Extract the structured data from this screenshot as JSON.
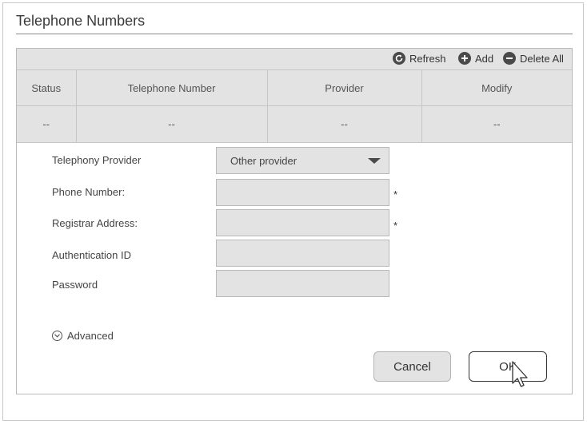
{
  "header": {
    "title": "Telephone Numbers"
  },
  "toolbar": {
    "refresh_label": "Refresh",
    "add_label": "Add",
    "delete_all_label": "Delete All"
  },
  "table": {
    "columns": [
      "Status",
      "Telephone Number",
      "Provider",
      "Modify"
    ],
    "rows": [
      [
        "--",
        "--",
        "--",
        "--"
      ]
    ]
  },
  "form": {
    "provider": {
      "label": "Telephony Provider",
      "value": "Other provider"
    },
    "phone": {
      "label": "Phone Number:",
      "value": "",
      "required_mark": "*"
    },
    "registrar": {
      "label": "Registrar Address:",
      "value": "",
      "required_mark": "*"
    },
    "auth_id": {
      "label": "Authentication ID",
      "value": ""
    },
    "password": {
      "label": "Password",
      "value": ""
    },
    "advanced_label": "Advanced"
  },
  "actions": {
    "cancel_label": "Cancel",
    "ok_label": "OK"
  },
  "icons": {
    "refresh": "refresh-icon",
    "add": "plus-circle-icon",
    "delete": "minus-circle-icon",
    "advanced": "chevron-down-circle-icon",
    "cursor": "mouse-pointer-icon"
  },
  "colors": {
    "panel_fill": "#e3e3e3",
    "border": "#b9b9b9",
    "text": "#333333"
  }
}
